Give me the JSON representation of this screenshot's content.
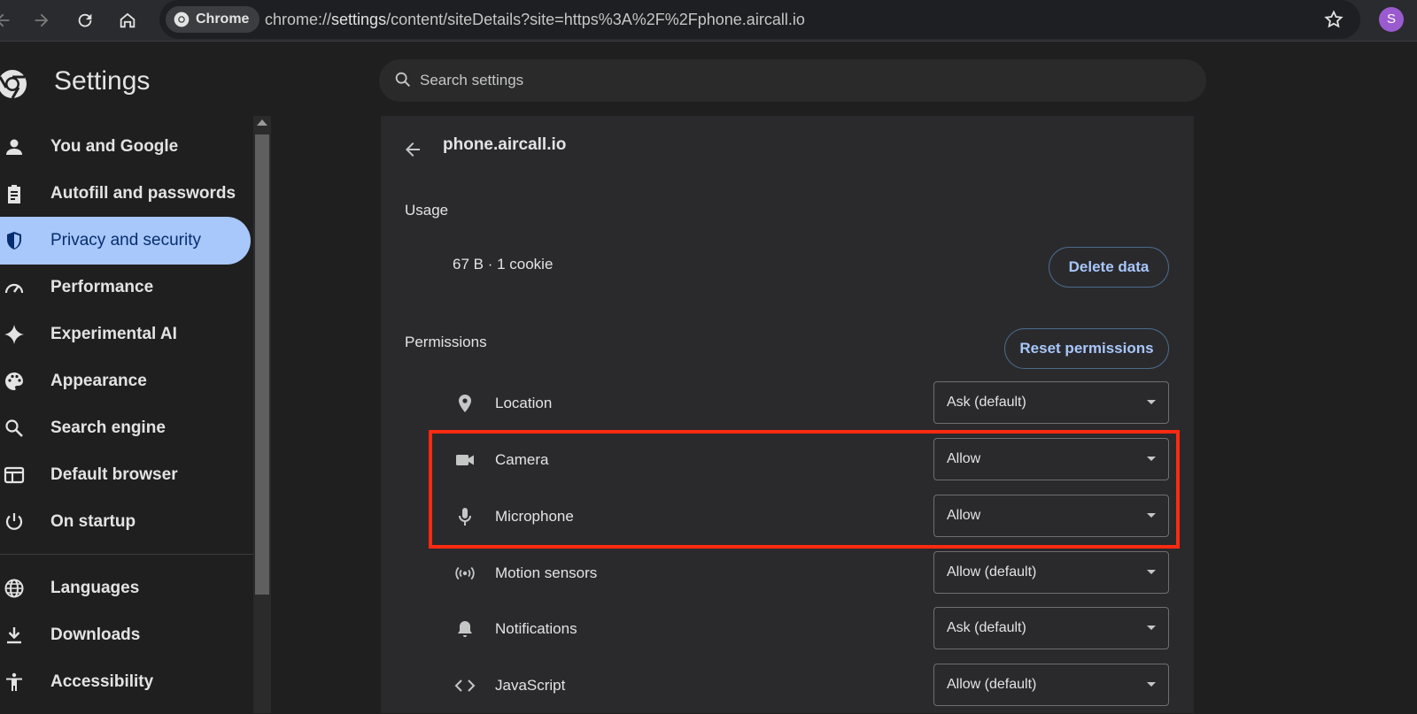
{
  "browser": {
    "chip_label": "Chrome",
    "url_prefix": "chrome://",
    "url_host": "settings",
    "url_path": "/content/siteDetails?site=https%3A%2F%2Fphone.aircall.io",
    "avatar_letter": "S"
  },
  "header": {
    "title": "Settings",
    "search_placeholder": "Search settings"
  },
  "sidebar": {
    "items": [
      {
        "label": "You and Google",
        "icon": "person-icon"
      },
      {
        "label": "Autofill and passwords",
        "icon": "clipboard-icon"
      },
      {
        "label": "Privacy and security",
        "icon": "shield-icon",
        "active": true
      },
      {
        "label": "Performance",
        "icon": "speedometer-icon"
      },
      {
        "label": "Experimental AI",
        "icon": "sparkle-icon"
      },
      {
        "label": "Appearance",
        "icon": "palette-icon"
      },
      {
        "label": "Search engine",
        "icon": "search-icon"
      },
      {
        "label": "Default browser",
        "icon": "browser-icon"
      },
      {
        "label": "On startup",
        "icon": "power-icon"
      },
      {
        "label": "Languages",
        "icon": "globe-icon"
      },
      {
        "label": "Downloads",
        "icon": "download-icon"
      },
      {
        "label": "Accessibility",
        "icon": "accessibility-icon"
      }
    ]
  },
  "site": {
    "name": "phone.aircall.io",
    "usage_heading": "Usage",
    "usage_value": "67 B · 1 cookie",
    "delete_label": "Delete data",
    "permissions_heading": "Permissions",
    "reset_label": "Reset permissions",
    "permissions": [
      {
        "label": "Location",
        "value": "Ask (default)",
        "icon": "location-pin-icon"
      },
      {
        "label": "Camera",
        "value": "Allow",
        "icon": "camera-icon"
      },
      {
        "label": "Microphone",
        "value": "Allow",
        "icon": "microphone-icon"
      },
      {
        "label": "Motion sensors",
        "value": "Allow (default)",
        "icon": "motion-sensors-icon"
      },
      {
        "label": "Notifications",
        "value": "Ask (default)",
        "icon": "bell-icon"
      },
      {
        "label": "JavaScript",
        "value": "Allow (default)",
        "icon": "code-icon"
      }
    ]
  },
  "colors": {
    "accent": "#a8c7fa",
    "highlight": "#ff2a10"
  }
}
